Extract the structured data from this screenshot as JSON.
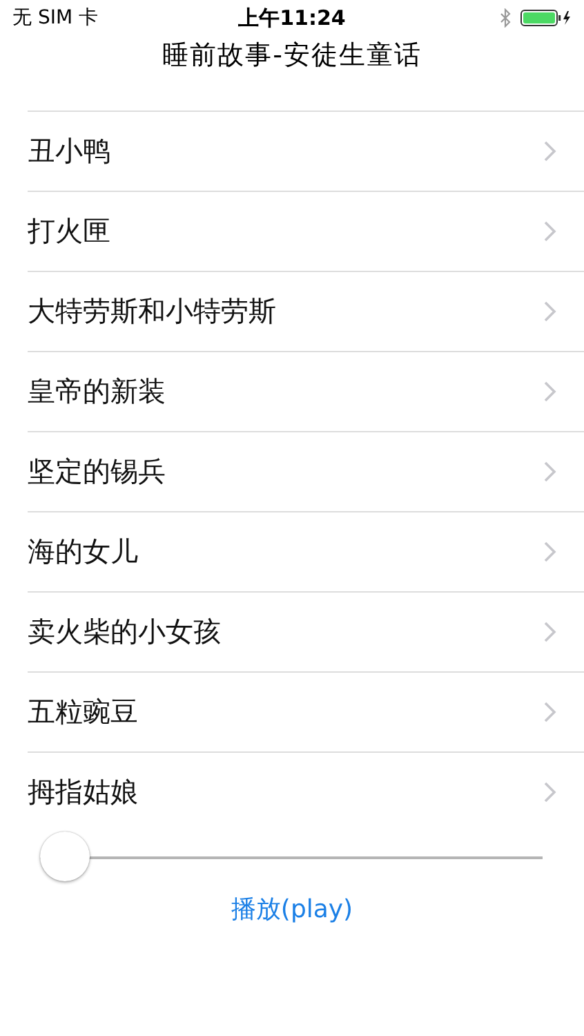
{
  "status_bar": {
    "carrier": "无 SIM 卡",
    "time": "上午11:24"
  },
  "nav": {
    "title": "睡前故事-安徒生童话"
  },
  "stories": [
    {
      "title": "丑小鸭"
    },
    {
      "title": "打火匣"
    },
    {
      "title": "大特劳斯和小特劳斯"
    },
    {
      "title": "皇帝的新装"
    },
    {
      "title": "坚定的锡兵"
    },
    {
      "title": "海的女儿"
    },
    {
      "title": "卖火柴的小女孩"
    },
    {
      "title": "五粒豌豆"
    },
    {
      "title": "拇指姑娘"
    }
  ],
  "slider": {
    "level": 0
  },
  "play_button": {
    "label": "播放(play)"
  }
}
